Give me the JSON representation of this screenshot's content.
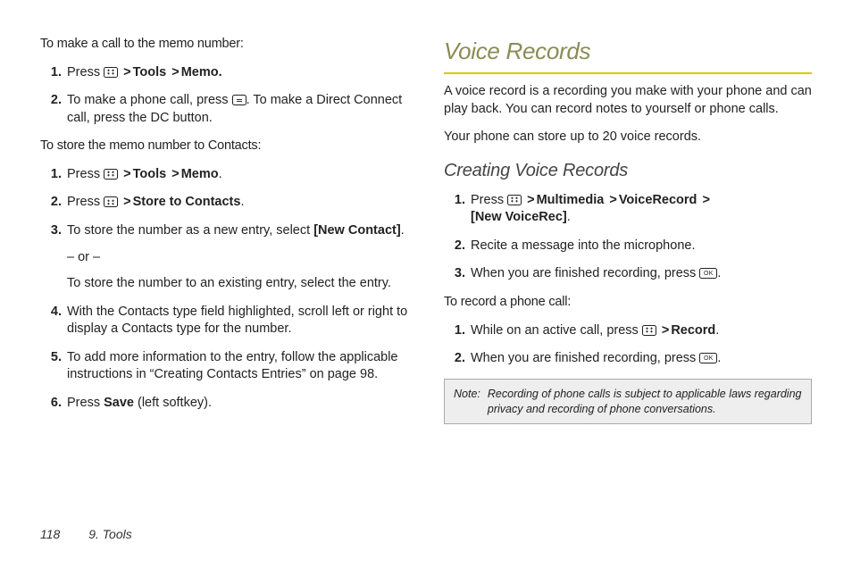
{
  "left": {
    "lead1": "To make a call to the memo number:",
    "list1": {
      "i1_pre": "Press ",
      "i1_path": "Tools",
      "i1_path2": "Memo.",
      "i2_a": "To make a phone call, press ",
      "i2_b": ". To make a Direct Connect call, press the DC button."
    },
    "lead2": "To store the memo number to Contacts:",
    "list2": {
      "i1_pre": "Press ",
      "i1_path": "Tools",
      "i1_path2": "Memo",
      "i2_pre": "Press ",
      "i2_path": "Store to Contacts",
      "i3_a": "To store the number as a new entry, select ",
      "i3_b": "[New Contact]",
      "i3_or": "– or –",
      "i3_c": "To store the number to an existing entry, select the entry.",
      "i4": "With the Contacts type field highlighted, scroll left or right to display a Contacts type for the number.",
      "i5": "To add more information to the entry, follow the applicable instructions in “Creating Contacts Entries” on page 98.",
      "i6_a": "Press ",
      "i6_b": "Save",
      "i6_c": " (left softkey)."
    }
  },
  "right": {
    "h1": "Voice Records",
    "p1": "A voice record is a recording you make with your phone and can play back. You can record notes to yourself or phone calls.",
    "p2": "Your phone can store up to 20 voice records.",
    "h2": "Creating Voice Records",
    "list1": {
      "i1_pre": "Press ",
      "i1_a": "Multimedia",
      "i1_b": "VoiceRecord",
      "i1_c": "[New VoiceRec]",
      "i2": "Recite a message into the microphone.",
      "i3_a": "When you are finished recording, press ",
      "i3_b": "."
    },
    "lead2": "To record a phone call:",
    "list2": {
      "i1_a": "While on an active call, press ",
      "i1_b": "Record",
      "i2_a": "When you are finished recording, press ",
      "i2_b": "."
    },
    "note_label": "Note:",
    "note_text": "Recording of phone calls is subject to applicable laws regarding privacy and recording of phone conversations."
  },
  "footer": {
    "page": "118",
    "chapter": "9. Tools"
  },
  "glyphs": {
    "gt": ">"
  }
}
